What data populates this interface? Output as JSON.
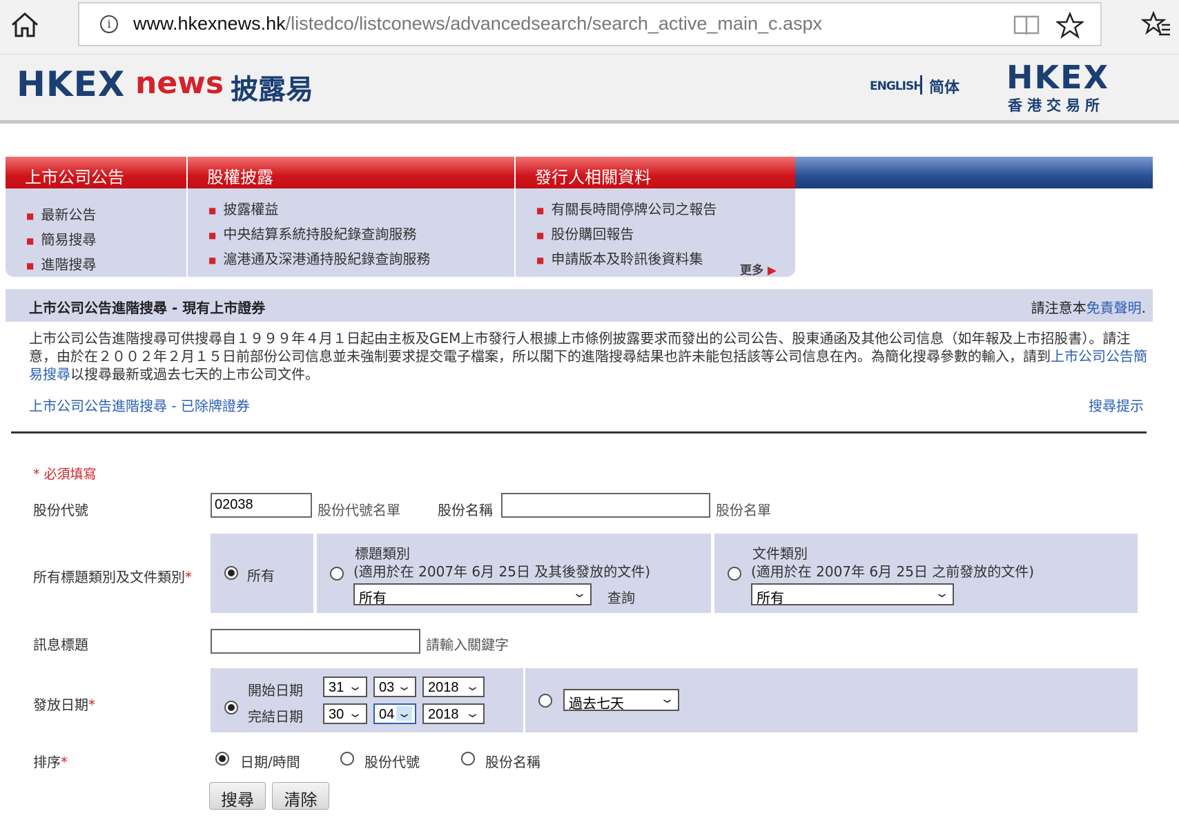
{
  "browser": {
    "url_domain": "www.hkexnews.hk",
    "url_path": "/listedco/listconews/advancedsearch/search_active_main_c.aspx"
  },
  "header": {
    "logo_hkex": "HKEX",
    "logo_news": "news",
    "logo_zh": "披露易",
    "lang_english": "ENGLISH",
    "lang_simplified": "简体",
    "brand": "HKEX",
    "brand_zh": "香港交易所"
  },
  "nav": {
    "tabs": [
      {
        "label": "上市公司公告",
        "items": [
          "最新公告",
          "簡易搜尋",
          "進階搜尋"
        ]
      },
      {
        "label": "股權披露",
        "items": [
          "披露權益",
          "中央結算系統持股紀錄查詢服務",
          "滬港通及深港通持股紀錄查詢服務"
        ]
      },
      {
        "label": "發行人相關資料",
        "items": [
          "有關長時間停牌公司之報告",
          "股份購回報告",
          "申請版本及聆訊後資料集"
        ]
      }
    ],
    "more": "更多"
  },
  "page": {
    "title": "上市公司公告進階搜尋 - 現有上市證券",
    "disclaimer_prefix": "請注意本",
    "disclaimer_link": "免責聲明",
    "disclaimer_suffix": ".",
    "desc_part1": "上市公司公告進階搜尋可供搜尋自１９９９年４月１日起由主板及GEM上市發行人根據上市條例披露要求而發出的公司公告、股東通函及其他公司信息（如年報及上市招股書）。請注意，由於在２００２年２月１５日前部份公司信息並未強制要求提交電子檔案，所以閣下的進階搜尋結果也許未能包括該等公司信息在內。為簡化搜尋參數的輸入，請到",
    "desc_link": "上市公司公告簡易搜尋",
    "desc_part2": "以搜尋最新或過去七天的上市公司文件。",
    "delisted_link": "上市公司公告進階搜尋 - 已除牌證券",
    "tips_link": "搜尋提示"
  },
  "form": {
    "required_note": "* 必須填寫",
    "stock_code_label": "股份代號",
    "stock_code_value": "02038",
    "stock_code_list": "股份代號名單",
    "stock_name_label": "股份名稱",
    "stock_name_value": "",
    "stock_name_list": "股份名單",
    "category_label": "所有標題類別及文件類別",
    "asterisk": "*",
    "all_option": "所有",
    "headline_title": "標題類別",
    "headline_note": "(適用於在 2007年 6月 25日 及其後發放的文件)",
    "headline_select": "所有",
    "headline_query": "查詢",
    "doc_title": "文件類別",
    "doc_note": "(適用於在 2007年 6月 25日 之前發放的文件)",
    "doc_select": "所有",
    "news_title_label": "訊息標題",
    "news_title_value": "",
    "news_title_hint": "請輸入關鍵字",
    "date_label": "發放日期",
    "start_label": "開始日期",
    "end_label": "完結日期",
    "start_day": "31",
    "start_month": "03",
    "start_year": "2018",
    "end_day": "30",
    "end_month": "04",
    "end_year": "2018",
    "past_seven": "過去七天",
    "sort_label": "排序",
    "sort_opts": [
      "日期/時間",
      "股份代號",
      "股份名稱"
    ],
    "search_btn": "搜尋",
    "clear_btn": "清除"
  },
  "colors": {
    "brand_red": "#d2232a",
    "brand_navy": "#1b3f73",
    "panel": "#d4d6ea",
    "link": "#2b5fb6"
  }
}
